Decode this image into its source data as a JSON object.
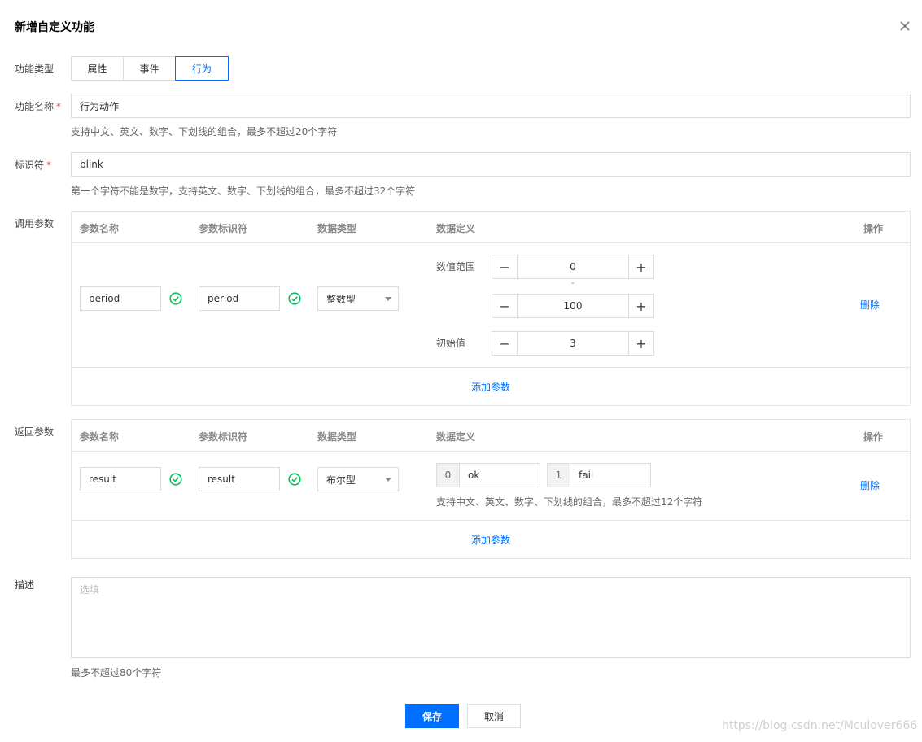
{
  "dialog": {
    "title": "新增自定义功能"
  },
  "form": {
    "type_label": "功能类型",
    "type_options": [
      "属性",
      "事件",
      "行为"
    ],
    "name_label": "功能名称",
    "name_value": "行为动作",
    "name_hint": "支持中文、英文、数字、下划线的组合，最多不超过20个字符",
    "id_label": "标识符",
    "id_value": "blink",
    "id_hint": "第一个字符不能是数字，支持英文、数字、下划线的组合，最多不超过32个字符",
    "required_mark": "*"
  },
  "table_headers": {
    "name": "参数名称",
    "identifier": "参数标识符",
    "type": "数据类型",
    "definition": "数据定义",
    "action": "操作"
  },
  "call_params": {
    "label": "调用参数",
    "row": {
      "name": "period",
      "identifier": "period",
      "type": "整数型",
      "range_label": "数值范围",
      "min": "0",
      "range_sep": "-",
      "max": "100",
      "init_label": "初始值",
      "init": "3",
      "delete": "删除"
    },
    "add": "添加参数"
  },
  "return_params": {
    "label": "返回参数",
    "row": {
      "name": "result",
      "identifier": "result",
      "type": "布尔型",
      "false_key": "0",
      "false_val": "ok",
      "true_key": "1",
      "true_val": "fail",
      "hint": "支持中文、英文、数字、下划线的组合，最多不超过12个字符",
      "delete": "删除"
    },
    "add": "添加参数"
  },
  "desc": {
    "label": "描述",
    "placeholder": "选填",
    "hint": "最多不超过80个字符"
  },
  "footer": {
    "save": "保存",
    "cancel": "取消"
  },
  "stepper_symbols": {
    "minus": "−",
    "plus": "+"
  },
  "watermark": "https://blog.csdn.net/Mculover666",
  "colors": {
    "primary": "#006eff",
    "success": "#0abf5b",
    "required": "#e54545"
  }
}
